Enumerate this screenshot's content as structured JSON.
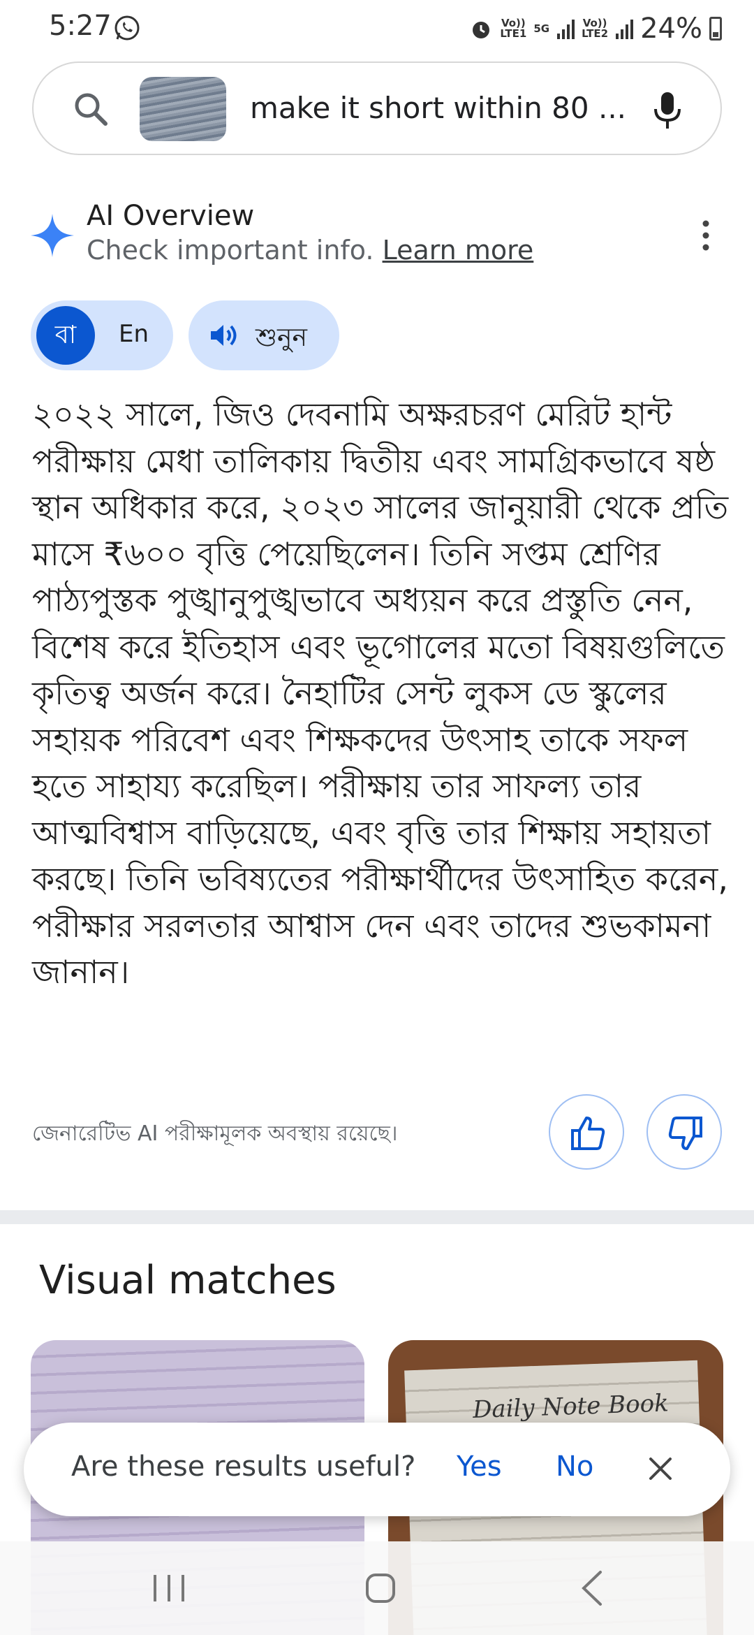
{
  "status_bar": {
    "time": "5:27",
    "battery": "24%",
    "sim1_top": "Vo))",
    "sim1_bottom": "LTE1",
    "network": "5G",
    "sim2_top": "Vo))",
    "sim2_bottom": "LTE2"
  },
  "search": {
    "query": "make it short within 80 ..."
  },
  "ai_overview": {
    "title": "AI Overview",
    "subtitle": "Check important info.",
    "learn_more": "Learn more",
    "lang_bn": "বা",
    "lang_en": "En",
    "listen": "শুনুন",
    "text": "২০২২ সালে, জিও দেবনামি অক্ষরচরণ মেরিট হান্ট পরীক্ষায় মেধা তালিকায় দ্বিতীয় এবং সামগ্রিকভাবে ষষ্ঠ স্থান অধিকার করে, ২০২৩ সালের জানুয়ারী থেকে প্রতি মাসে ₹৬০০ বৃত্তি পেয়েছিলেন। তিনি সপ্তম শ্রেণির পাঠ্যপুস্তক পুঙ্খানুপুঙ্খভাবে অধ্যয়ন করে প্রস্তুতি নেন, বিশেষ করে ইতিহাস এবং ভূগোলের মতো বিষয়গুলিতে কৃতিত্ব অর্জন করে। নৈহাটির সেন্ট লুকস ডে স্কুলের সহায়ক পরিবেশ এবং শিক্ষকদের উৎসাহ তাকে সফল হতে সাহায্য করেছিল। পরীক্ষায় তার সাফল্য তার আত্মবিশ্বাস বাড়িয়েছে, এবং বৃত্তি তার শিক্ষায় সহায়তা করছে। তিনি ভবিষ্যতের পরীক্ষার্থীদের উৎসাহিত করেন, পরীক্ষার সরলতার আশ্বাস দেন এবং তাদের শুভকামনা জানান।",
    "disclaimer": "জেনারেটিভ AI পরীক্ষামূলক অবস্থায় রয়েছে।"
  },
  "visual_matches": {
    "title": "Visual matches",
    "card2_text": "Daily Note Book"
  },
  "feedback_toast": {
    "question": "Are these results useful?",
    "yes": "Yes",
    "no": "No"
  },
  "colors": {
    "accent": "#0b57d0",
    "chip_bg": "#d3e3fd"
  }
}
